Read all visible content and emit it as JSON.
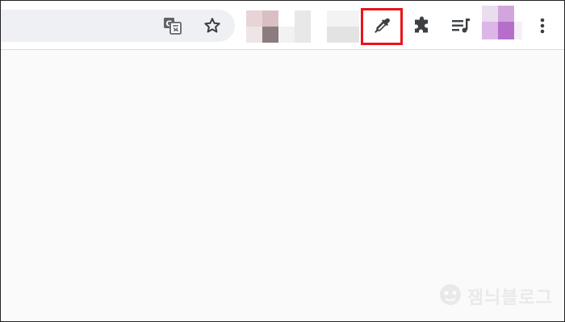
{
  "toolbar": {
    "icons": {
      "translate": "translate-icon",
      "bookmark": "bookmark-star-icon",
      "eyedropper": "eyedropper-icon",
      "extensions": "puzzle-extensions-icon",
      "media": "media-control-icon",
      "menu": "kebab-menu-icon"
    },
    "highlight_color": "#e8141b"
  },
  "watermark": {
    "text": "잼늬블로그"
  }
}
